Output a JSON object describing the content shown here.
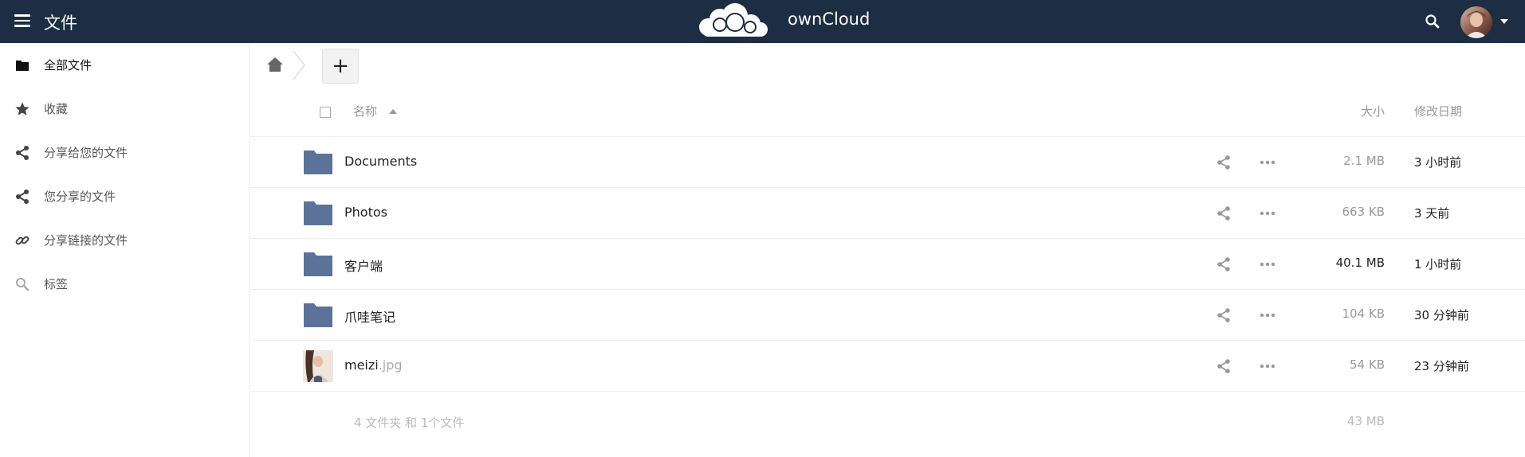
{
  "header": {
    "app_title": "文件",
    "brand": "ownCloud",
    "colors": {
      "header_bg": "#1d2d44",
      "folder": "#5b7399"
    }
  },
  "sidebar": {
    "items": [
      {
        "label": "全部文件",
        "icon": "folder-icon",
        "active": true
      },
      {
        "label": "收藏",
        "icon": "star-icon"
      },
      {
        "label": "分享给您的文件",
        "icon": "share-icon"
      },
      {
        "label": "您分享的文件",
        "icon": "share-icon"
      },
      {
        "label": "分享链接的文件",
        "icon": "link-icon"
      },
      {
        "label": "标签",
        "icon": "search-icon"
      }
    ]
  },
  "controls": {
    "new_label": "+"
  },
  "list": {
    "headers": {
      "name": "名称",
      "size": "大小",
      "date": "修改日期"
    },
    "rows": [
      {
        "name": "Documents",
        "ext": "",
        "type": "folder",
        "size": "2.1 MB",
        "date": "3 小时前"
      },
      {
        "name": "Photos",
        "ext": "",
        "type": "folder",
        "size": "663 KB",
        "date": "3 天前"
      },
      {
        "name": "客户端",
        "ext": "",
        "type": "folder",
        "size": "40.1 MB",
        "date": "1 小时前"
      },
      {
        "name": "爪哇笔记",
        "ext": "",
        "type": "folder",
        "size": "104 KB",
        "date": "30 分钟前"
      },
      {
        "name": "meizi",
        "ext": ".jpg",
        "type": "image",
        "size": "54 KB",
        "date": "23 分钟前"
      }
    ],
    "summary": {
      "text": "4 文件夹 和 1个文件",
      "size": "43 MB"
    }
  }
}
